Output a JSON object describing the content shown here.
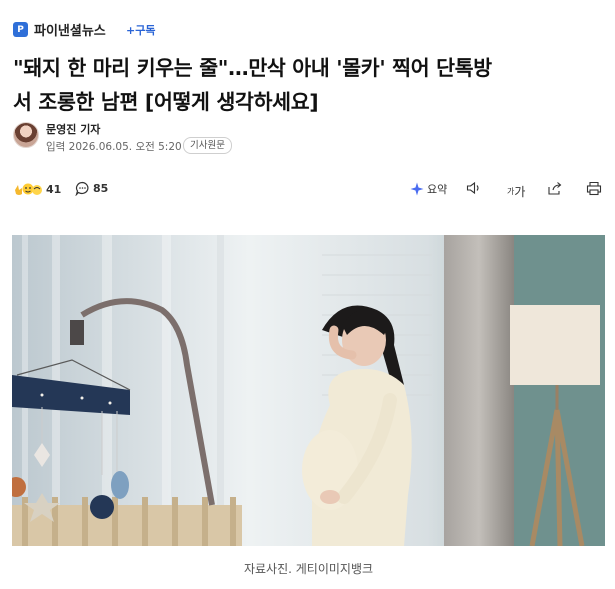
{
  "publisher": {
    "logo_letter": "P",
    "name": "파이낸셜뉴스",
    "subscribe_label": "+구독"
  },
  "article": {
    "headline_line1": "\"돼지 한 마리 키우는 줄\"…만삭 아내 '몰카' 찍어 단톡방",
    "headline_line2": "서 조롱한 남편 [어떻게 생각하세요]",
    "author": "문영진 기자",
    "published": "입력 2026.06.05. 오전 5:20",
    "origin_label": "기사원문",
    "photo_caption": "자료사진. 게티이미지뱅크"
  },
  "toolbar": {
    "reaction_count": "41",
    "comment_count": "85",
    "summary_label": "요약",
    "font_size_label": "가"
  },
  "colors": {
    "accent": "#2a64d6",
    "summary_star": "#4a6cf0"
  }
}
